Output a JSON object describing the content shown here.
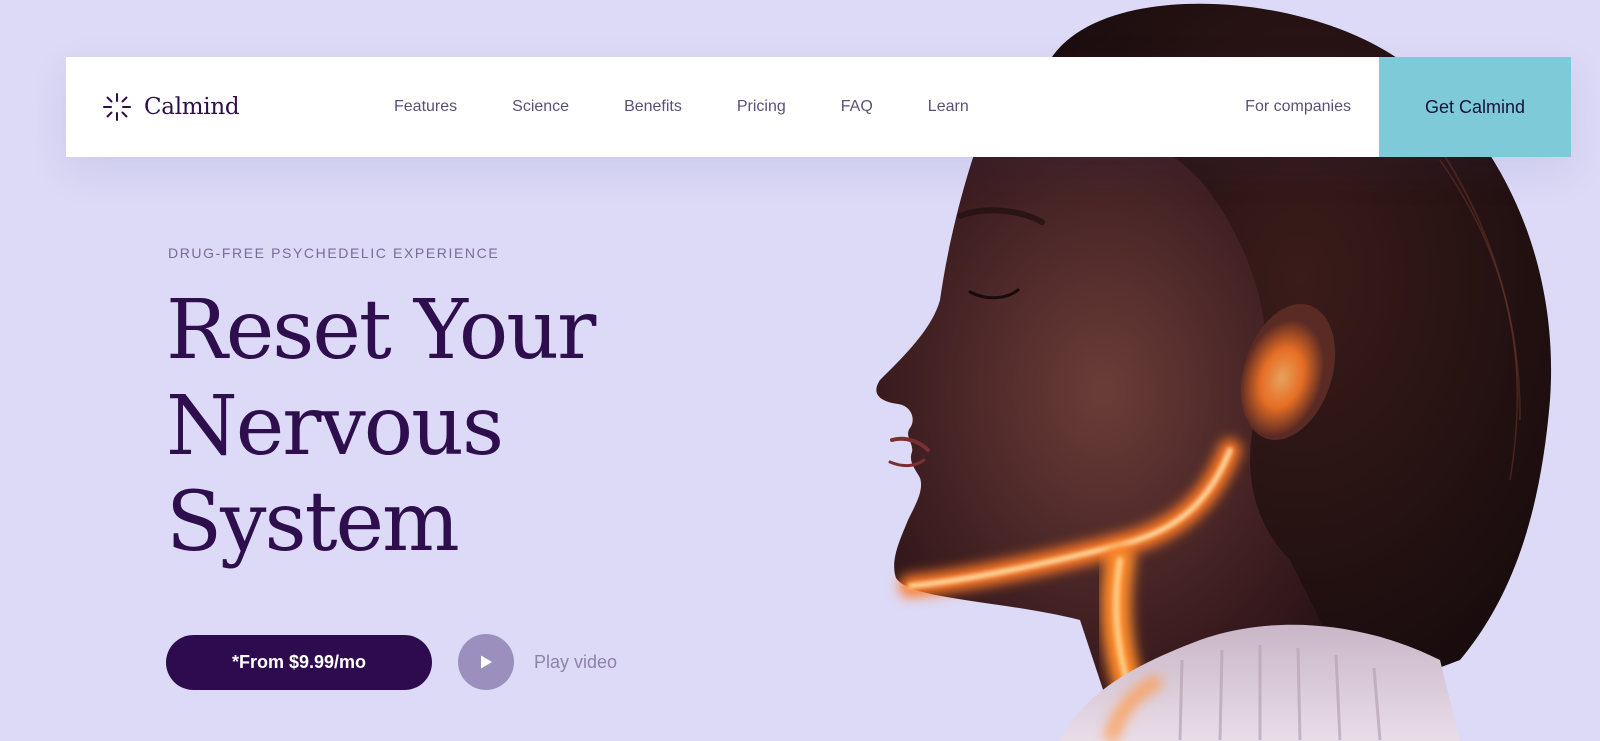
{
  "colors": {
    "background": "#dcdaf6",
    "brand_dark": "#2e0b4e",
    "accent": "#7ecad8",
    "nav_text": "#5e4f78",
    "play_circle": "#9b8fbe",
    "glow": "#ff8a2a"
  },
  "nav": {
    "brand": "Calmind",
    "brand_icon": "sparkle-icon",
    "links": [
      "Features",
      "Science",
      "Benefits",
      "Pricing",
      "FAQ",
      "Learn"
    ],
    "for_companies": "For companies",
    "cta": "Get Calmind"
  },
  "hero": {
    "eyebrow": "DRUG-FREE PSYCHEDELIC EXPERIENCE",
    "headline": [
      "Reset Your",
      "Nervous",
      "System"
    ],
    "price_button": "*From $9.99/mo",
    "play_icon": "play-icon",
    "play_label": "Play video",
    "image_subject": "woman-profile-illustration"
  }
}
